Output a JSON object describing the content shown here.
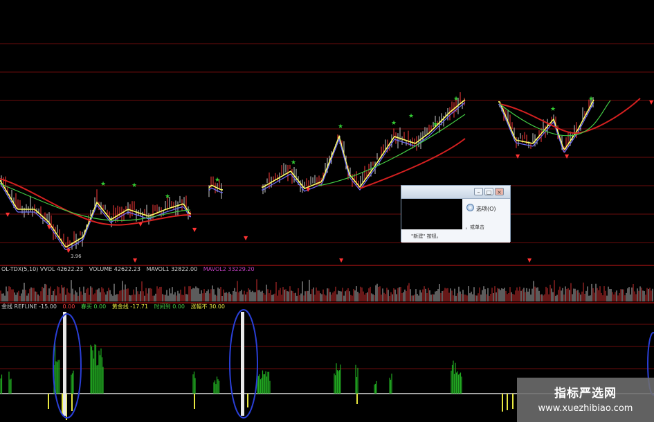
{
  "colors": {
    "background": "#000000",
    "grid": "#6b0d0d",
    "price_up": "#ff3b3b",
    "price_down": "#6f6fff",
    "ma_short": "#ffff66",
    "ma_mid": "#44cc44",
    "ma_long": "#d42020",
    "buy_marker": "#33cc33",
    "sell_marker": "#ff3333",
    "indicator_pos": "#22aa22",
    "indicator_neg": "#e8e840",
    "refline": "#d9d9d9",
    "highlight_circle": "#2a3fd6"
  },
  "main_chart": {
    "price_label": "3.96"
  },
  "volume_panel": {
    "legend": [
      {
        "text": "OL-TDX(5,10) VVOL  42622.23",
        "color": "#cfcfcf"
      },
      {
        "text": "VOLUME  42622.23",
        "color": "#cfcfcf"
      },
      {
        "text": "MAVOL1  32822.00",
        "color": "#cfcfcf"
      },
      {
        "text": "MAVOL2  33229.20",
        "color": "#c040c0"
      }
    ]
  },
  "indicator_panel": {
    "legend": [
      {
        "text": "金线  REFLINE  -15.00",
        "color": "#cfcfcf"
      },
      {
        "text": "0.00",
        "color": "#ff4040"
      },
      {
        "text": "春买  0.00",
        "color": "#44cc44"
      },
      {
        "text": "黄金线  -17.71",
        "color": "#e8e840"
      },
      {
        "text": "时间到  0.00",
        "color": "#44cc44"
      },
      {
        "text": "涨幅不  30.00",
        "color": "#e8e840"
      }
    ]
  },
  "dialog": {
    "options_label": "选项(O)",
    "options_icon": "gear-icon",
    "line1": "，或单击",
    "line2": "\"新建\" 按钮。",
    "buttons": [
      "minimize",
      "maximize",
      "close"
    ]
  },
  "watermark": {
    "title": "指标严选网",
    "url": "www.xuezhibiao.com"
  }
}
